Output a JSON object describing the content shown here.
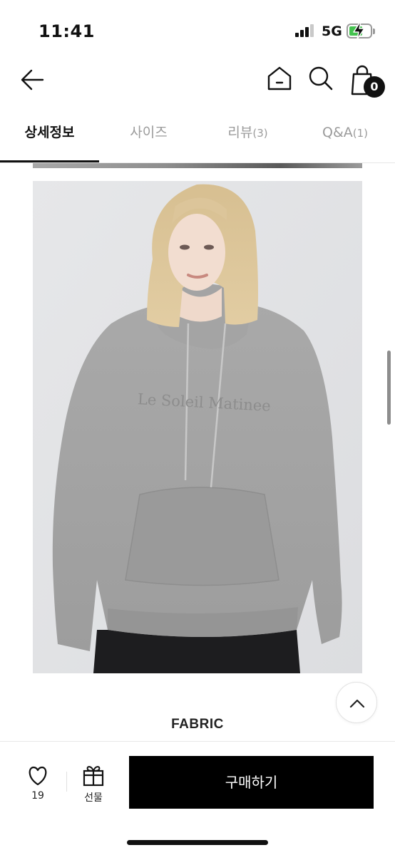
{
  "status_bar": {
    "time": "11:41",
    "network": "5G",
    "battery_color": "#44c24f"
  },
  "nav": {
    "back_icon": "arrow-left-icon",
    "home_icon": "home-icon",
    "search_icon": "search-icon",
    "cart_icon": "shopping-bag-icon",
    "cart_count": "0"
  },
  "tabs": [
    {
      "label": "상세정보",
      "count": "",
      "active": true
    },
    {
      "label": "사이즈",
      "count": "",
      "active": false
    },
    {
      "label": "리뷰",
      "count": "(3)",
      "active": false
    },
    {
      "label": "Q&A",
      "count": "(1)",
      "active": false
    }
  ],
  "product_image": {
    "embroidery_text": "Le Soleil Matinee"
  },
  "section": {
    "title": "FABRIC"
  },
  "scroll_top_icon": "chevron-up-icon",
  "bottom_bar": {
    "like_icon": "heart-icon",
    "like_count": "19",
    "gift_icon": "gift-icon",
    "gift_label": "선물",
    "buy_label": "구매하기"
  },
  "colors": {
    "accent": "#000000",
    "tab_inactive": "#9b9b9b",
    "background": "#ffffff"
  }
}
